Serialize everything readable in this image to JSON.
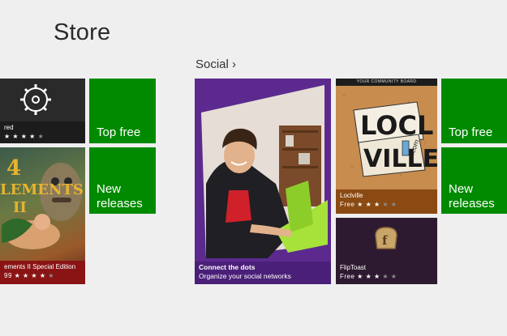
{
  "page": {
    "title": "Store"
  },
  "section": {
    "header": "Social ›"
  },
  "left_group": {
    "app1": {
      "name": "red",
      "rating": 4
    },
    "app2": {
      "name": "ements II Special Edition",
      "price": "99",
      "rating": 4
    },
    "top_free": "Top free",
    "new_releases": [
      "New",
      "releases"
    ]
  },
  "social_group": {
    "hero": {
      "title": "Connect the dots",
      "subtitle": "Organize your social networks"
    },
    "locliville": {
      "name": "Loclville",
      "price": "Free",
      "rating": 3,
      "banner": "YOUR COMMUNITY BOARD",
      "logo_top": "LOCL",
      "logo_bottom": "VILLE",
      "logo_com": ".com"
    },
    "fliptoast": {
      "name": "FlipToast",
      "price": "Free",
      "rating": 3
    },
    "top_free": "Top free",
    "new_releases": [
      "New",
      "releases"
    ]
  },
  "colors": {
    "green": "#008a00",
    "purple": "#5c2a8f",
    "brown": "#8a4a12",
    "dark_purple": "#2e1a30",
    "dark": "#2a2a2a"
  }
}
